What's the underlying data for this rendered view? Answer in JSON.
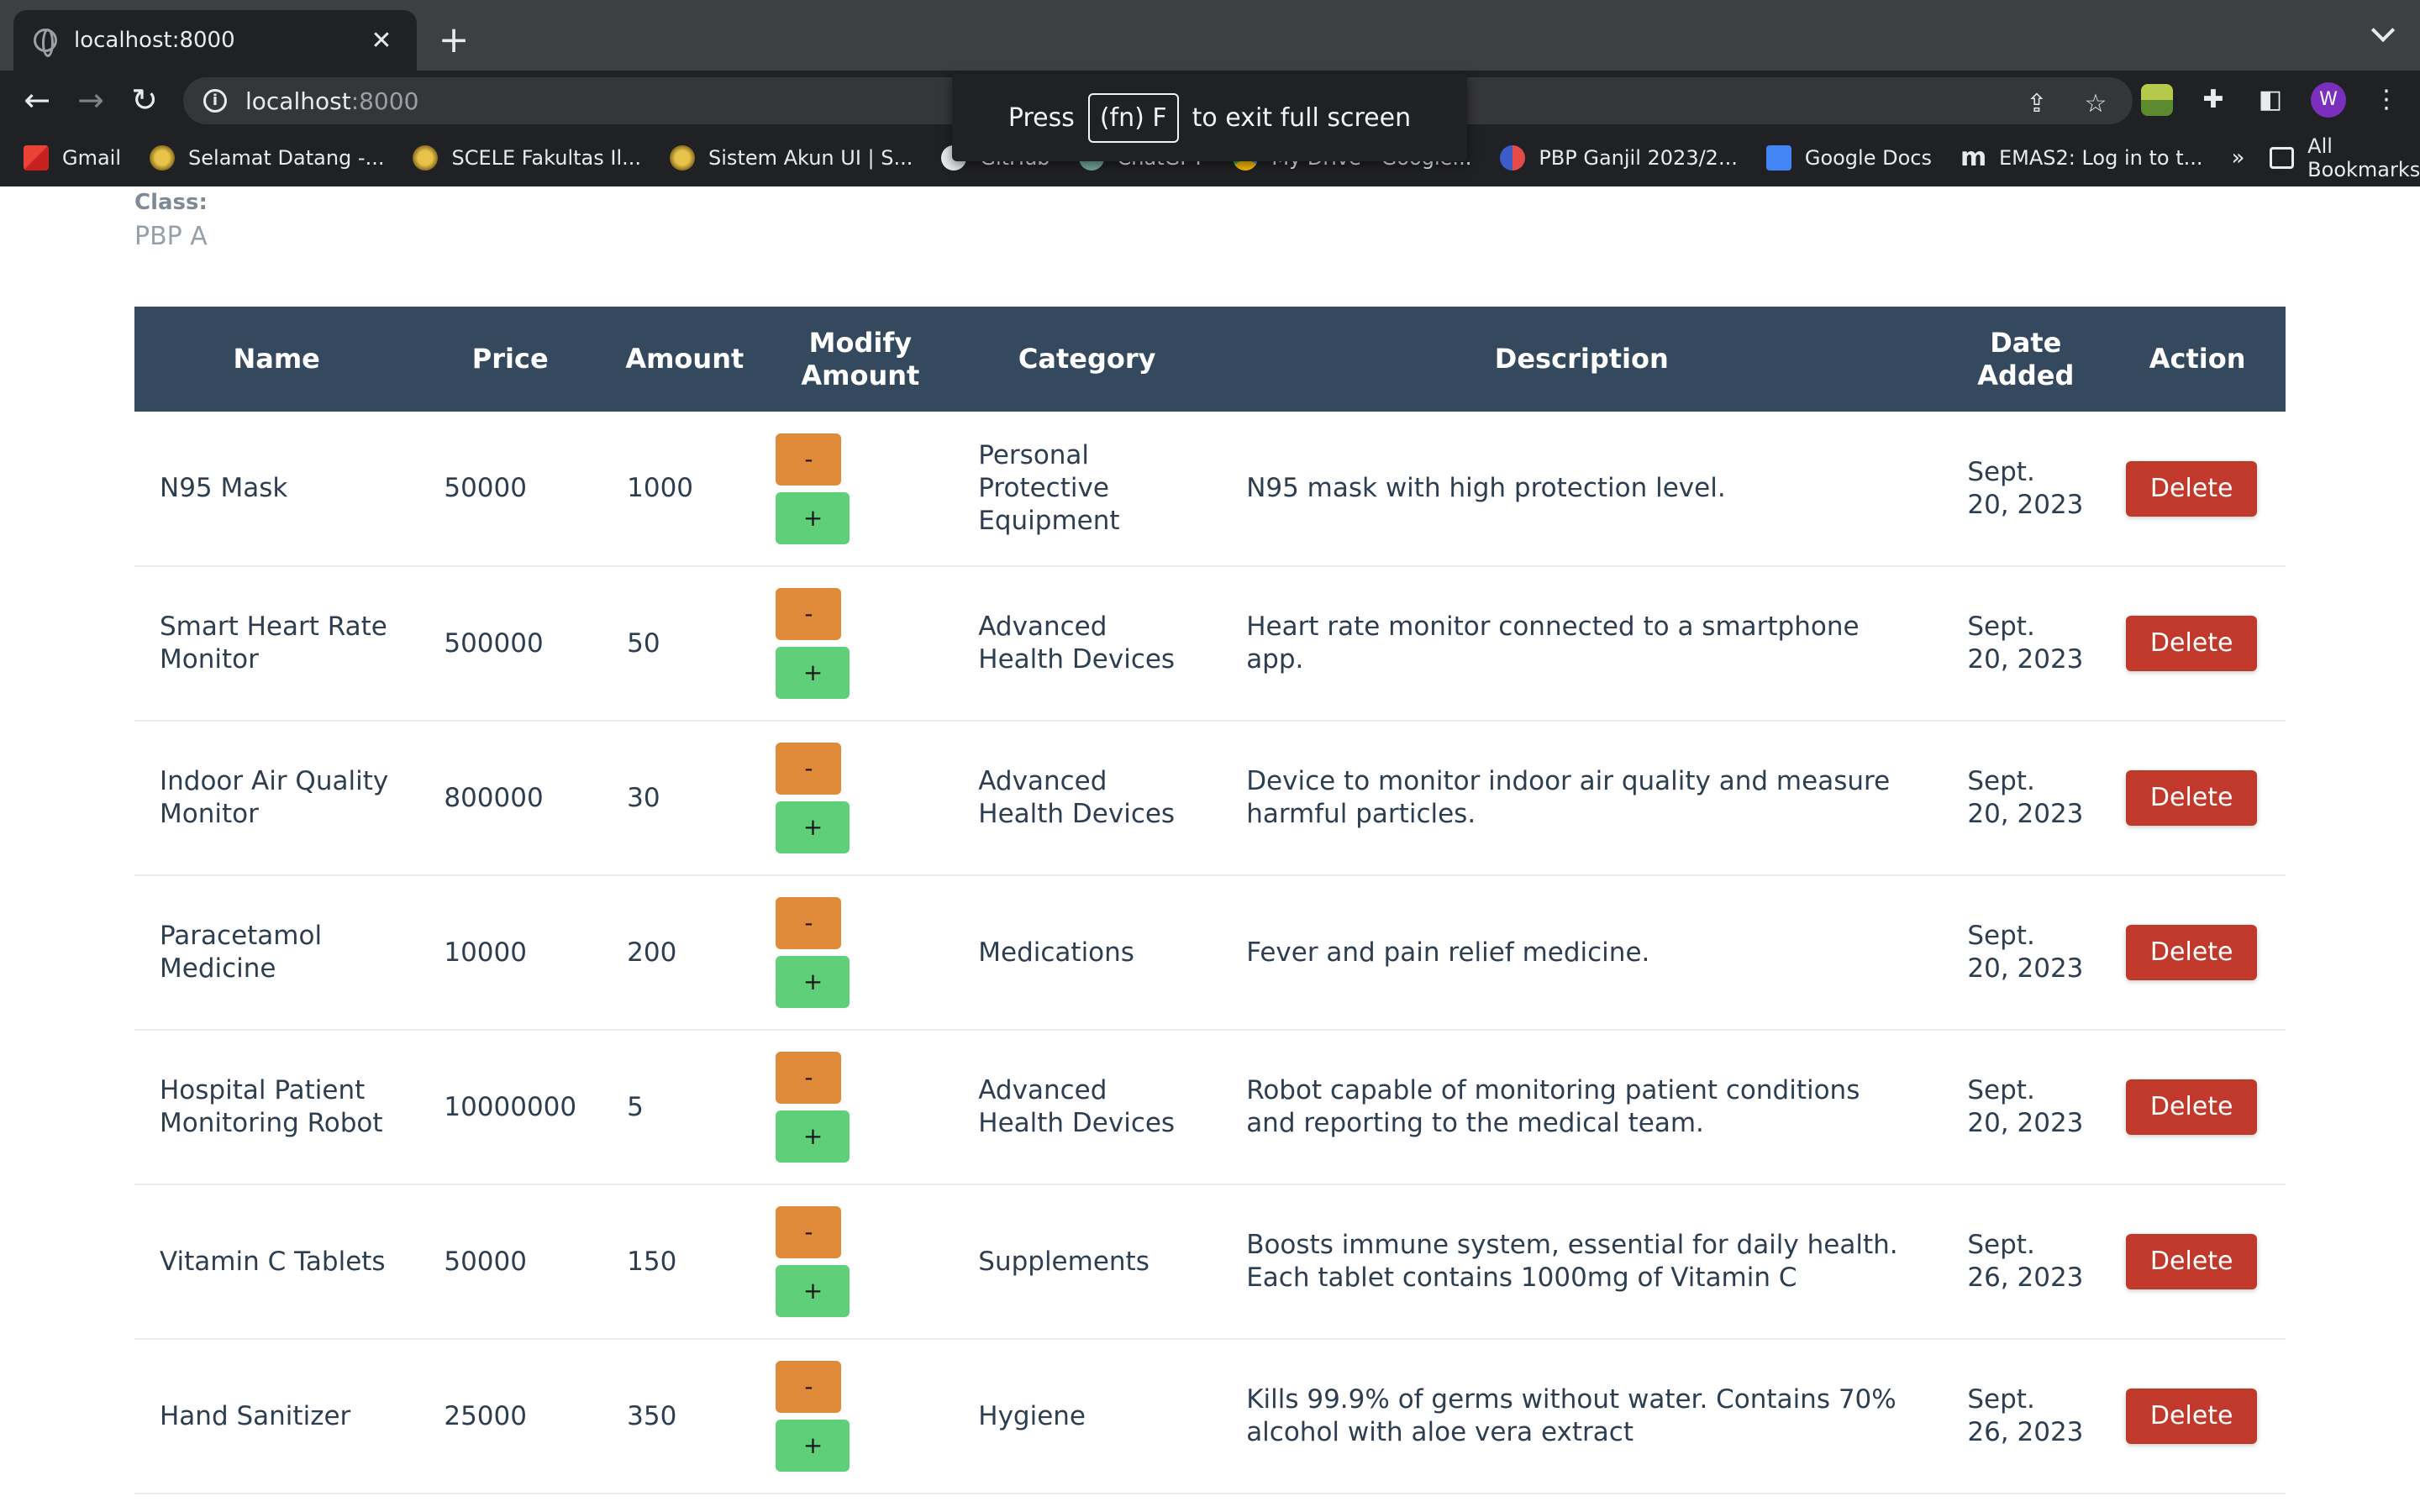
{
  "browser": {
    "tab_title": "localhost:8000",
    "url_host": "localhost",
    "url_port": ":8000",
    "bookmarks": [
      {
        "label": "Gmail",
        "icon": "gmail-icon"
      },
      {
        "label": "Selamat Datang -...",
        "icon": "ui-seal-icon"
      },
      {
        "label": "SCELE Fakultas Il...",
        "icon": "ui-seal-icon"
      },
      {
        "label": "Sistem Akun UI | S...",
        "icon": "ui-seal-icon"
      },
      {
        "label": "GitHub",
        "icon": "github-icon"
      },
      {
        "label": "ChatGPT",
        "icon": "chatgpt-icon"
      },
      {
        "label": "My Drive - Google...",
        "icon": "drive-icon"
      },
      {
        "label": "PBP Ganjil 2023/2...",
        "icon": "pbp-icon"
      },
      {
        "label": "Google Docs",
        "icon": "docs-icon"
      },
      {
        "label": "EMAS2: Log in to t...",
        "icon": "emas-icon"
      }
    ],
    "more_bookmarks": "»",
    "all_bookmarks": "All Bookmarks",
    "avatar_letter": "W",
    "fullscreen_notice": {
      "press": "Press",
      "key": "(fn) F",
      "rest": "to exit full screen"
    }
  },
  "page": {
    "class_label": "Class:",
    "class_value": "PBP A"
  },
  "table": {
    "headers": {
      "name": "Name",
      "price": "Price",
      "amount": "Amount",
      "modify_line1": "Modify",
      "modify_line2": "Amount",
      "category": "Category",
      "description": "Description",
      "date_line1": "Date",
      "date_line2": "Added",
      "action": "Action"
    },
    "minus_label": "-",
    "plus_label": "+",
    "delete_label": "Delete",
    "rows": [
      {
        "name": "N95 Mask",
        "price": "50000",
        "amount": "1000",
        "category": "Personal Protective Equipment",
        "description": "N95 mask with high protection level.",
        "date": "Sept. 20, 2023"
      },
      {
        "name": "Smart Heart Rate Monitor",
        "price": "500000",
        "amount": "50",
        "category": "Advanced Health Devices",
        "description": "Heart rate monitor connected to a smartphone app.",
        "date": "Sept. 20, 2023"
      },
      {
        "name": "Indoor Air Quality Monitor",
        "price": "800000",
        "amount": "30",
        "category": "Advanced Health Devices",
        "description": "Device to monitor indoor air quality and measure harmful particles.",
        "date": "Sept. 20, 2023"
      },
      {
        "name": "Paracetamol Medicine",
        "price": "10000",
        "amount": "200",
        "category": "Medications",
        "description": "Fever and pain relief medicine.",
        "date": "Sept. 20, 2023"
      },
      {
        "name": "Hospital Patient Monitoring Robot",
        "price": "10000000",
        "amount": "5",
        "category": "Advanced Health Devices",
        "description": "Robot capable of monitoring patient conditions and reporting to the medical team.",
        "date": "Sept. 20, 2023"
      },
      {
        "name": "Vitamin C Tablets",
        "price": "50000",
        "amount": "150",
        "category": "Supplements",
        "description": "Boosts immune system, essential for daily health. Each tablet contains 1000mg of Vitamin C",
        "date": "Sept. 26, 2023"
      },
      {
        "name": "Hand Sanitizer",
        "price": "25000",
        "amount": "350",
        "category": "Hygiene",
        "description": "Kills 99.9% of germs without water. Contains 70% alcohol with aloe vera extract",
        "date": "Sept. 26, 2023"
      }
    ]
  },
  "colors": {
    "header_bg": "#34495e",
    "minus_btn": "#e08b3a",
    "plus_btn": "#5fcf7a",
    "delete_btn": "#c0392b"
  }
}
